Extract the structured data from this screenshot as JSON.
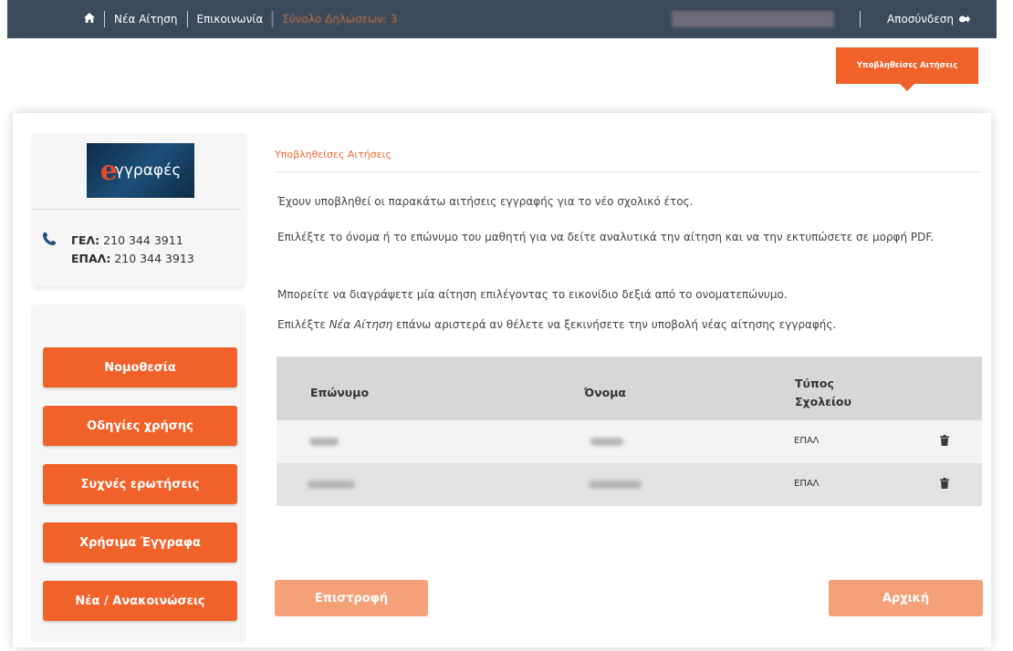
{
  "nav": {
    "home_icon": "home-icon",
    "new_application": "Νέα Αίτηση",
    "contact": "Επικοινωνία",
    "declarations_total": "Σύνολο Δηλώσεων: 3",
    "logout": "Αποσύνδεση",
    "logout_icon": "sign-out-icon"
  },
  "tab_badge": "Υποβληθείσες Αιτήσεις",
  "sidebar": {
    "logo_initial": "e",
    "logo_text": "γγραφές",
    "phones": [
      {
        "label": "ΓΕΛ:",
        "number": "210 344 3911"
      },
      {
        "label": "ΕΠΑΛ:",
        "number": "210 344 3913"
      }
    ],
    "menu": [
      "Νομοθεσία",
      "Οδηγίες χρήσης",
      "Συχνές ερωτήσεις",
      "Χρήσιμα Έγγραφα",
      "Νέα / Ανακοινώσεις"
    ]
  },
  "content": {
    "title": "Υποβληθείσες Αιτήσεις",
    "p1": "Έχουν υποβληθεί οι παρακάτω αιτήσεις εγγραφής για το νέο σχολικό έτος.",
    "p2": "Επιλέξτε το όνομα ή το επώνυμο του μαθητή για να δείτε αναλυτικά την αίτηση και να την εκτυπώσετε σε μορφή PDF.",
    "p3": "Μπορείτε να διαγράψετε μία αίτηση επιλέγοντας το εικονίδιο δεξιά από το ονοματεπώνυμο.",
    "p4_before": "Επιλέξτε ",
    "p4_italic": "Νέα Αίτηση",
    "p4_after": " επάνω αριστερά αν θέλετε να ξεκινήσετε την υποβολή νέας αίτησης εγγραφής."
  },
  "table": {
    "headers": [
      "Επώνυμο",
      "Όνομα",
      "Τύπος Σχολείου"
    ],
    "rows": [
      {
        "school_type": "ΕΠΑΛ",
        "delete_icon": "trash-icon"
      },
      {
        "school_type": "ΕΠΑΛ",
        "delete_icon": "trash-icon"
      }
    ]
  },
  "buttons": {
    "back": "Επιστροφή",
    "home": "Αρχική"
  },
  "colors": {
    "navbar": "#3b4a5a",
    "accent": "#f0622a",
    "accent_light": "#f6a07a"
  }
}
